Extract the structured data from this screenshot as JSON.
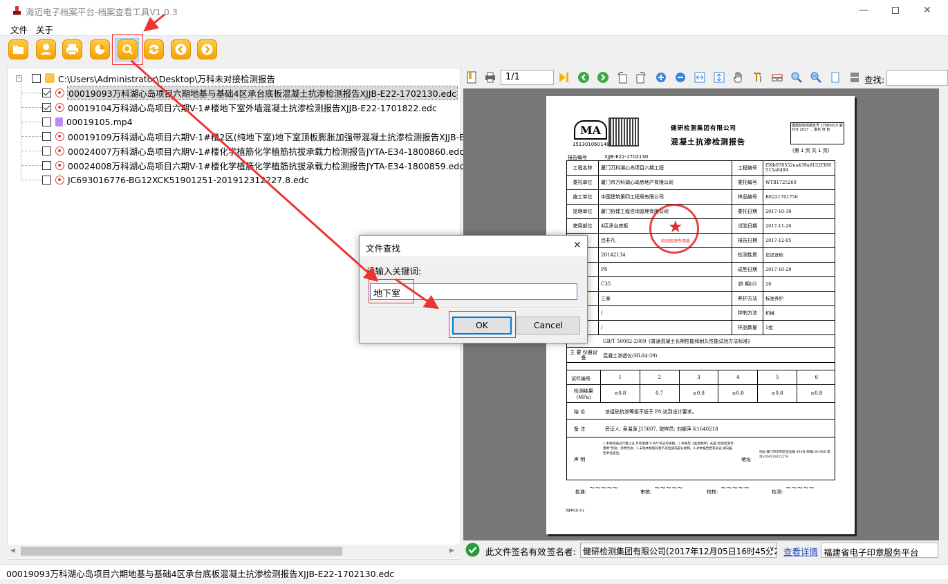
{
  "window": {
    "title": "海迈电子档案平台-档案查看工具V1.0.3"
  },
  "menu": {
    "file": "文件",
    "about": "关于"
  },
  "toolbar": {
    "icons": [
      "open-folder-icon",
      "user-icon",
      "print-icon",
      "chart-icon",
      "search-icon",
      "refresh-icon",
      "prev-icon",
      "next-icon"
    ]
  },
  "tree": {
    "root": "C:\\Users\\Administrator\\Desktop\\万科未对接检测报告",
    "items": [
      {
        "name": "00019093万科湖心岛项目六期地基与基础4区承台底板混凝土抗渗检测报告XJJB-E22-1702130.edc",
        "checked": true,
        "type": "edc"
      },
      {
        "name": "00019104万科湖心岛项目六期V-1#楼地下室外墙混凝土抗渗检测报告XJJB-E22-1701822.edc",
        "checked": true,
        "type": "edc"
      },
      {
        "name": "00019105.mp4",
        "checked": false,
        "type": "mp4"
      },
      {
        "name": "00019109万科湖心岛项目六期V-1#楼2区(纯地下室)地下室顶板膨胀加强带混凝土抗渗检测报告XJJB-E22",
        "checked": false,
        "type": "edc"
      },
      {
        "name": "00024007万科湖心岛项目六期V-1#楼化学植筋化学植筋抗拔承载力检测报告JYTA-E34-1800860.edc",
        "checked": false,
        "type": "edc"
      },
      {
        "name": "00024008万科湖心岛项目六期V-1#楼化学植筋化学植筋抗拔承载力检测报告JYTA-E34-1800859.edc",
        "checked": false,
        "type": "edc"
      },
      {
        "name": "JC693016776-BG12XCK51901251-201912312227.8.edc",
        "checked": false,
        "type": "edc"
      }
    ]
  },
  "status": {
    "text": "00019093万科湖心岛项目六期地基与基础4区承台底板混凝土抗渗检测报告XJJB-E22-1702130.edc"
  },
  "viewer": {
    "page": "1/1",
    "find_label": "查找:",
    "signature": {
      "valid": "此文件签名有效",
      "signer_label": "签名者:",
      "signer": "健研检测集团有限公司(2017年12月05日16时45分2",
      "details": "查看详情",
      "platform": "福建省电子印章服务平台"
    }
  },
  "document": {
    "org": "健研检测集团有限公司",
    "title": "混凝土抗渗检测报告",
    "ma": "MA",
    "ma_no": "151301060148",
    "pages": "(第 1 页 共 1 页)",
    "report_no_label": "报告编号",
    "report_no": "XJJB-E22-1702130",
    "rows": [
      [
        "工程名称",
        "厦门万科湖心岛项目六期工程",
        "工程编号",
        "f59b078552ea439a0152f369515a0d04"
      ],
      [
        "委托单位",
        "厦门市万科湖心岛房地产有限公司",
        "委托编号",
        "WTB1725260"
      ],
      [
        "施工单位",
        "中国建筑第四工程局有限公司",
        "样品编号",
        "BE221701756"
      ],
      [
        "监理单位",
        "厦门协建工程咨询监理有限公司",
        "委托日期",
        "2017-10-30"
      ],
      [
        "使用部位",
        "4区承台底板",
        "试验日期",
        "2017-11-26"
      ],
      [
        "员",
        "吕非凡",
        "报告日期",
        "2017-12-05"
      ],
      [
        "员号",
        "20142134",
        "检测性质",
        "见证送检"
      ],
      [
        "级",
        "P8",
        "成型日期",
        "2017-10-29"
      ],
      [
        "级",
        "C35",
        "龄 期(d)",
        "28"
      ],
      [
        "位",
        "三泰",
        "养护方法",
        "标准养护"
      ],
      [
        "号",
        "/",
        "拌制方法",
        "机械"
      ],
      [
        "比号",
        "/",
        "样品数量",
        "1组"
      ]
    ],
    "basis_label": "据",
    "basis": "GB/T 50082-2009《普通混凝土长期性能和耐久性能试验方法标准》",
    "equip_label": "主 要 仪器设备",
    "equip": "混凝土渗透仪(HL64-39)",
    "spec_label": "试件编号",
    "spec_nums": [
      "1",
      "2",
      "3",
      "4",
      "5",
      "6"
    ],
    "result_label": "检测结果(MPa)",
    "results": [
      "≥0.8",
      "0.7",
      "≥0.8",
      "≥0.8",
      "≥0.8",
      "≥0.8"
    ],
    "conclusion_label": "结 论",
    "conclusion": "该组砼抗渗等级不低于 P8,达到设计要求。",
    "note_label": "备 注",
    "note": "旁证人: 黄温源 J15007, 取样员: 刘娜萍 K1640218",
    "statement_label": "声 明",
    "statement": "1.本机构通过计量认证,享有使用\"CMA\"标志的资格。2.本报告《查复制件》未盖\"检验检测专用章\"无效。涂改无效。3.未经本机构同意不得全部或部分复制。4.对本报告若有异议,请向报告单位提出。",
    "address_label": "地址",
    "address": "地址:厦门市思明区莲岳路 405号 邮编:361008 电话:(0592)5023278",
    "approve": "批准:",
    "review": "审核:",
    "check": "校核:",
    "test": "检测:",
    "footer_code": "XJJ4b(J)-2-J",
    "stamp_text": "检验检测专用章"
  },
  "dialog": {
    "title": "文件查找",
    "prompt": "请输入关键词:",
    "value": "地下室",
    "ok": "OK",
    "cancel": "Cancel"
  }
}
